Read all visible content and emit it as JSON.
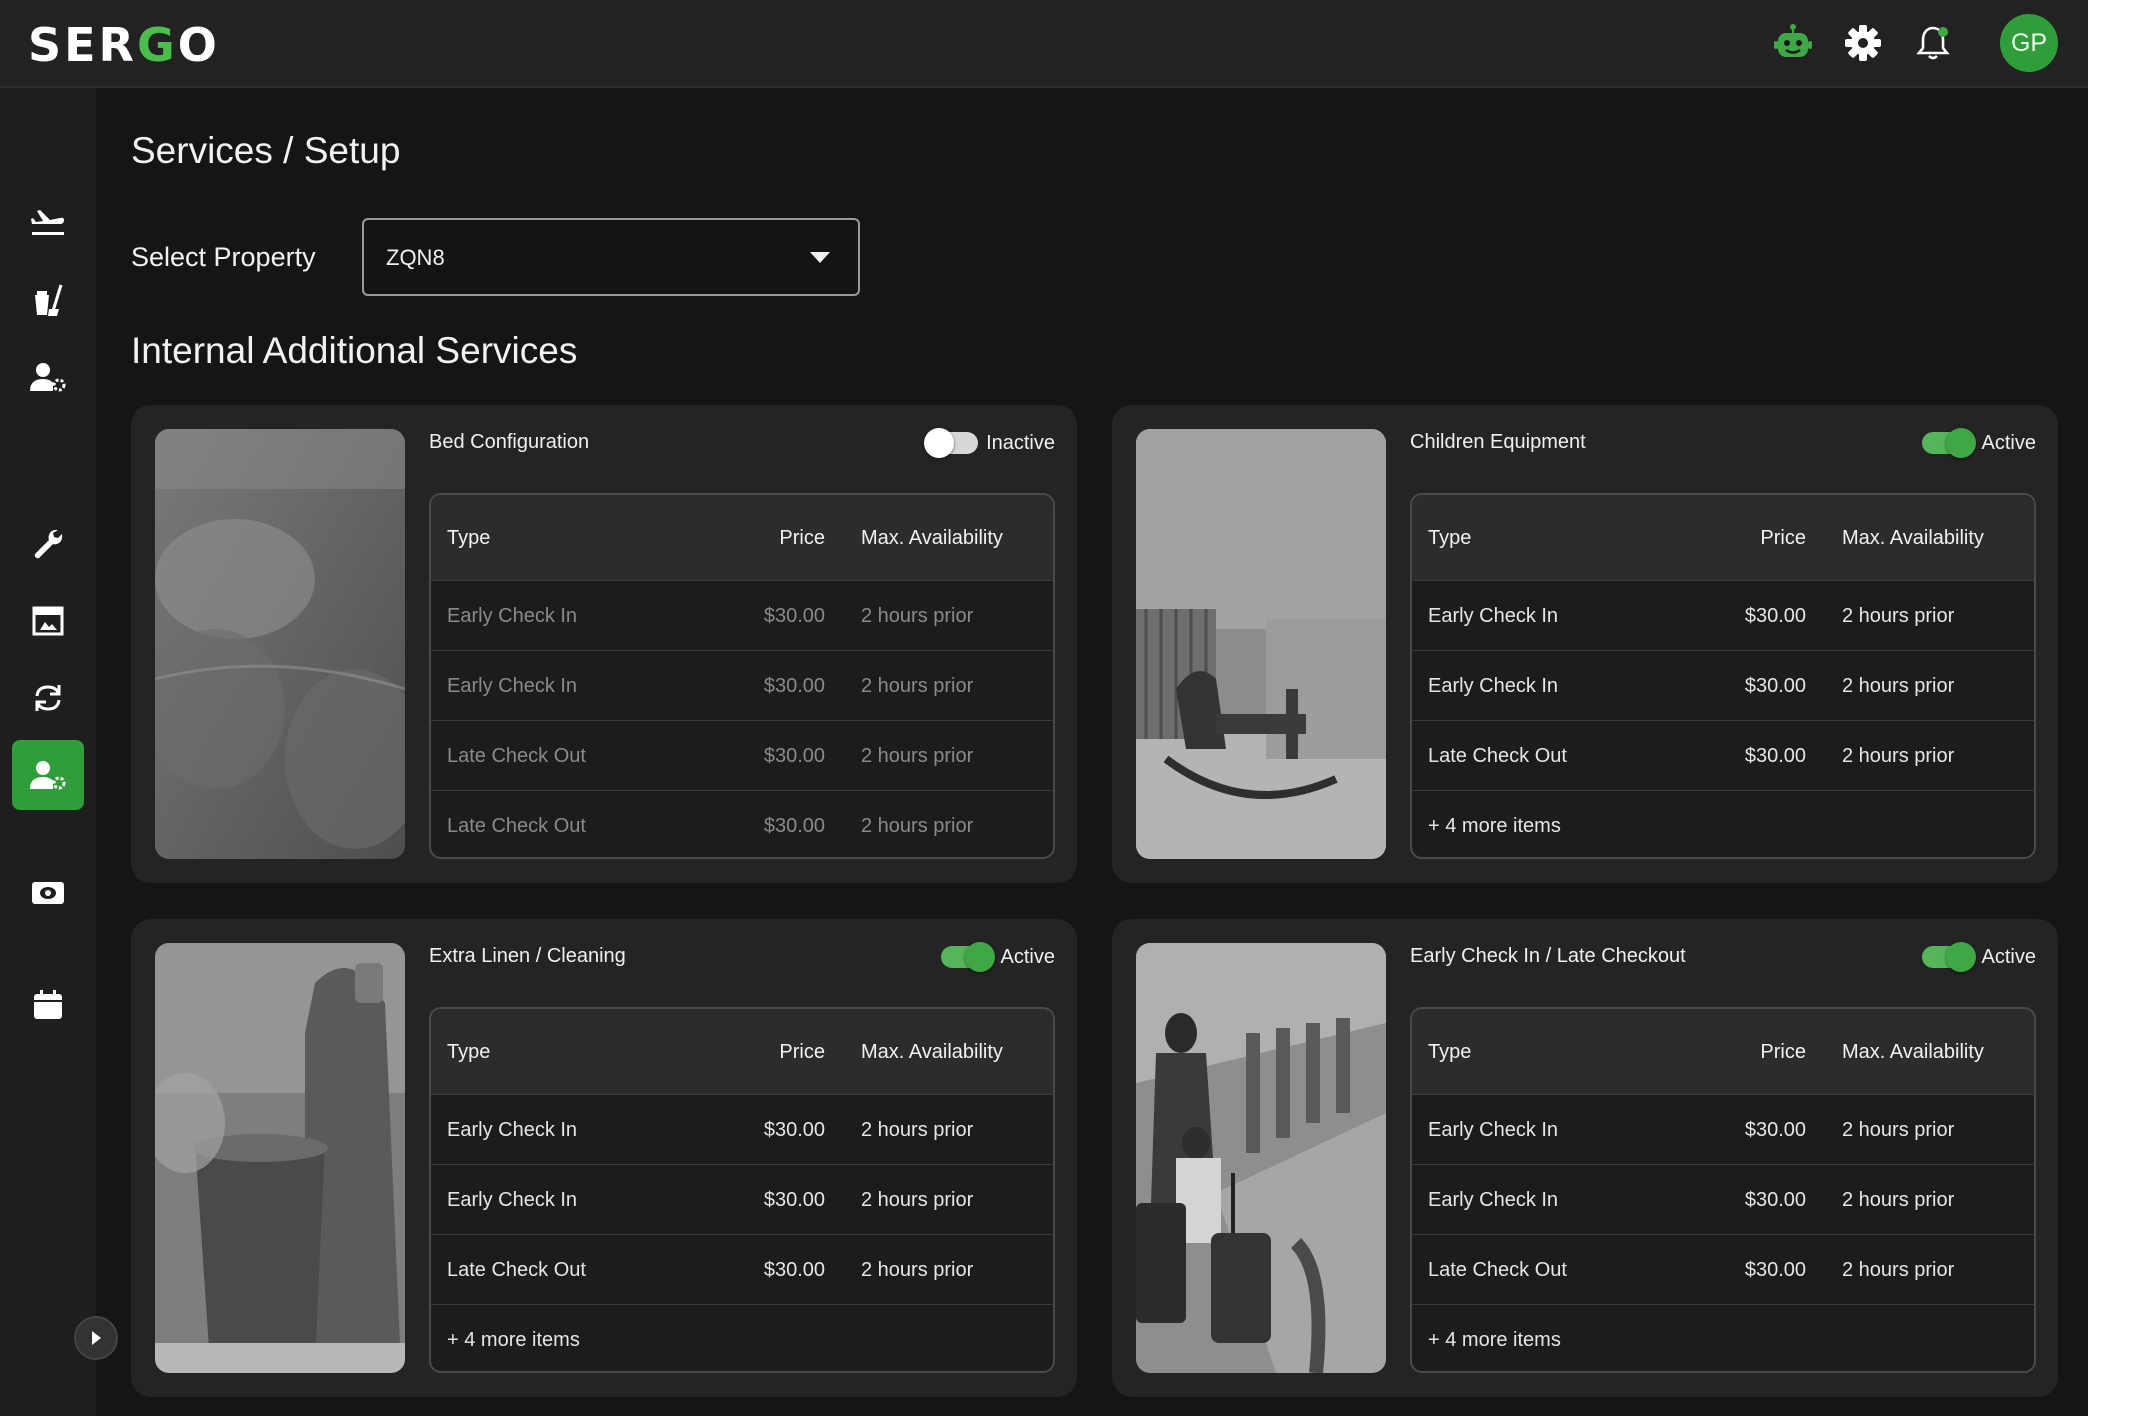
{
  "app": {
    "logo_prefix": "SER",
    "logo_accent": "G",
    "logo_suffix": "O",
    "accent_color": "#2f9e3a"
  },
  "header": {
    "icons": [
      "robot-icon",
      "gear-icon",
      "bell-icon"
    ],
    "avatar_initials": "GP"
  },
  "sidebar": {
    "items": [
      "airplane-icon",
      "cleaning-icon",
      "user-settings-icon",
      "wrench-icon",
      "picture-icon",
      "sync-icon",
      "user-settings-icon-active",
      "cash-icon",
      "calendar-icon"
    ],
    "active_index": 6
  },
  "page": {
    "title": "Services / Setup",
    "select_label": "Select Property",
    "select_value": "ZQN8",
    "section_title": "Internal Additional Services"
  },
  "table_headers": {
    "type": "Type",
    "price": "Price",
    "availability": "Max. Availability"
  },
  "cards": [
    {
      "title": "Bed Configuration",
      "status": "Inactive",
      "active": false,
      "rows": [
        {
          "type": "Early Check In",
          "price": "$30.00",
          "availability": "2 hours prior"
        },
        {
          "type": "Early Check In",
          "price": "$30.00",
          "availability": "2 hours prior"
        },
        {
          "type": "Late Check Out",
          "price": "$30.00",
          "availability": "2 hours prior"
        },
        {
          "type": "Late Check Out",
          "price": "$30.00",
          "availability": "2 hours prior"
        }
      ],
      "more": ""
    },
    {
      "title": "Children Equipment",
      "status": "Active",
      "active": true,
      "rows": [
        {
          "type": "Early Check In",
          "price": "$30.00",
          "availability": "2 hours prior"
        },
        {
          "type": "Early Check In",
          "price": "$30.00",
          "availability": "2 hours prior"
        },
        {
          "type": "Late Check Out",
          "price": "$30.00",
          "availability": "2 hours prior"
        }
      ],
      "more": "+ 4 more items"
    },
    {
      "title": "Extra Linen / Cleaning",
      "status": "Active",
      "active": true,
      "rows": [
        {
          "type": "Early Check In",
          "price": "$30.00",
          "availability": "2 hours prior"
        },
        {
          "type": "Early Check In",
          "price": "$30.00",
          "availability": "2 hours prior"
        },
        {
          "type": "Late Check Out",
          "price": "$30.00",
          "availability": "2 hours prior"
        }
      ],
      "more": "+ 4 more items"
    },
    {
      "title": "Early Check In / Late Checkout",
      "status": "Active",
      "active": true,
      "rows": [
        {
          "type": "Early Check In",
          "price": "$30.00",
          "availability": "2 hours prior"
        },
        {
          "type": "Early Check In",
          "price": "$30.00",
          "availability": "2 hours prior"
        },
        {
          "type": "Late Check Out",
          "price": "$30.00",
          "availability": "2 hours prior"
        }
      ],
      "more": "+ 4 more items"
    }
  ]
}
